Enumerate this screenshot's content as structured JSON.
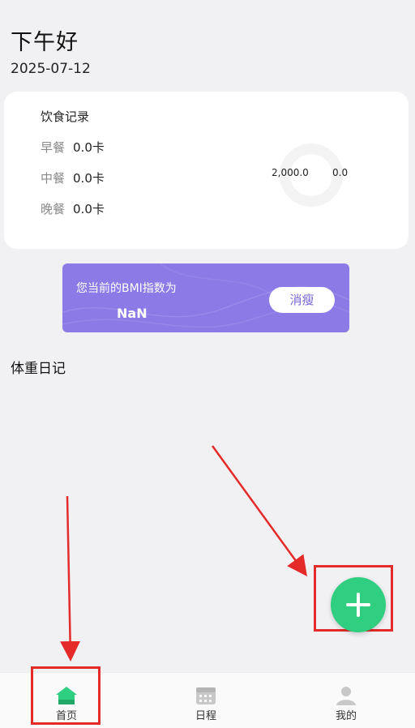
{
  "header": {
    "greeting": "下午好",
    "date": "2025-07-12"
  },
  "diet": {
    "title": "饮食记录",
    "meals": [
      {
        "label": "早餐",
        "value": "0.0卡"
      },
      {
        "label": "中餐",
        "value": "0.0卡"
      },
      {
        "label": "晚餐",
        "value": "0.0卡"
      }
    ],
    "stat_left": "2,000.0",
    "stat_right": "0.0"
  },
  "bmi": {
    "label": "您当前的BMI指数为",
    "value": "NaN",
    "button": "消瘦"
  },
  "weight": {
    "title": "体重日记"
  },
  "tabs": [
    {
      "label": "首页",
      "icon": "home-icon"
    },
    {
      "label": "日程",
      "icon": "calendar-icon"
    },
    {
      "label": "我的",
      "icon": "user-icon"
    }
  ],
  "colors": {
    "accent": "#2fce80",
    "bmi_card": "#8c7ae6",
    "annotation": "#e52a2a",
    "background": "#f1f1f3"
  },
  "fab": {
    "icon": "plus-icon"
  }
}
